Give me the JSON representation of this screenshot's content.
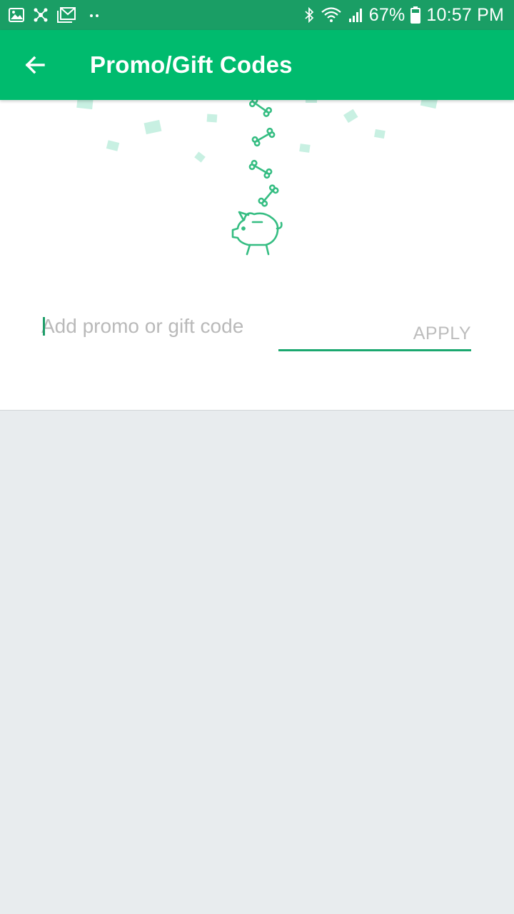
{
  "status_bar": {
    "battery": "67%",
    "time": "10:57 PM",
    "background": "#1a9e65"
  },
  "app_bar": {
    "title": "Promo/Gift Codes",
    "background": "#00bb6e"
  },
  "promo": {
    "placeholder": "Add promo or gift code",
    "value": "",
    "apply_label": "APPLY",
    "accent": "#1aa86f"
  },
  "content_background": "#e8ecee",
  "icons": [
    "gallery-icon",
    "network-icon",
    "gmail-icon",
    "more-notifications-icon",
    "bluetooth-icon",
    "wifi-icon",
    "signal-icon",
    "battery-icon",
    "back-arrow-icon",
    "piggy-bank-icon",
    "bone-icon",
    "confetti-icon"
  ]
}
